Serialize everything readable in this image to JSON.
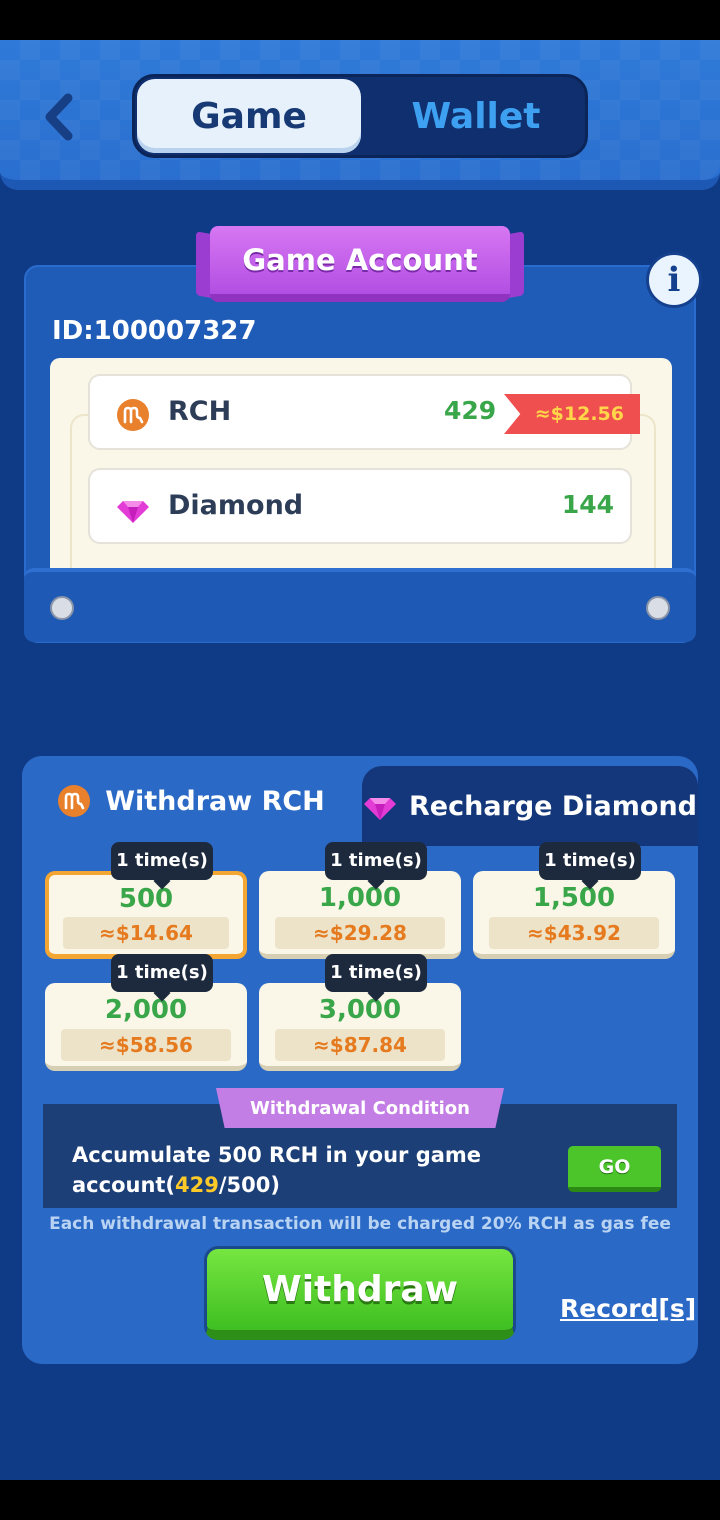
{
  "header": {
    "tabs": [
      {
        "label": "Game",
        "active": true
      },
      {
        "label": "Wallet",
        "active": false
      }
    ]
  },
  "account": {
    "title": "Game Account",
    "id_text": "ID:100007327",
    "assets": [
      {
        "name": "RCH",
        "value": "429",
        "usd": "≈$12.56",
        "icon": "rch-coin-icon"
      },
      {
        "name": "Diamond",
        "value": "144",
        "icon": "diamond-icon"
      }
    ]
  },
  "panel": {
    "tabs": [
      {
        "label": "Withdraw RCH",
        "active": true,
        "icon": "rch-coin-icon"
      },
      {
        "label": "Recharge Diamond",
        "active": false,
        "icon": "diamond-icon"
      }
    ],
    "options": [
      {
        "times": "1 time(s)",
        "amount": "500",
        "usd": "≈$14.64",
        "selected": true
      },
      {
        "times": "1 time(s)",
        "amount": "1,000",
        "usd": "≈$29.28",
        "selected": false
      },
      {
        "times": "1 time(s)",
        "amount": "1,500",
        "usd": "≈$43.92",
        "selected": false
      },
      {
        "times": "1 time(s)",
        "amount": "2,000",
        "usd": "≈$58.56",
        "selected": false
      },
      {
        "times": "1 time(s)",
        "amount": "3,000",
        "usd": "≈$87.84",
        "selected": false
      }
    ],
    "condition": {
      "title": "Withdrawal Condition",
      "text_prefix": "Accumulate 500 RCH in your game account(",
      "current": "429",
      "text_suffix": "/500)",
      "go_label": "GO"
    },
    "gas_note": "Each withdrawal transaction will be charged 20% RCH as gas fee",
    "withdraw_label": "Withdraw",
    "records_label": "Record[s]"
  },
  "colors": {
    "background": "#0f3a86",
    "accent_green": "#3aa64a",
    "usd_orange": "#e57a1f",
    "highlight_yellow": "#ffc928",
    "ribbon_purple": "#b24fe3"
  }
}
